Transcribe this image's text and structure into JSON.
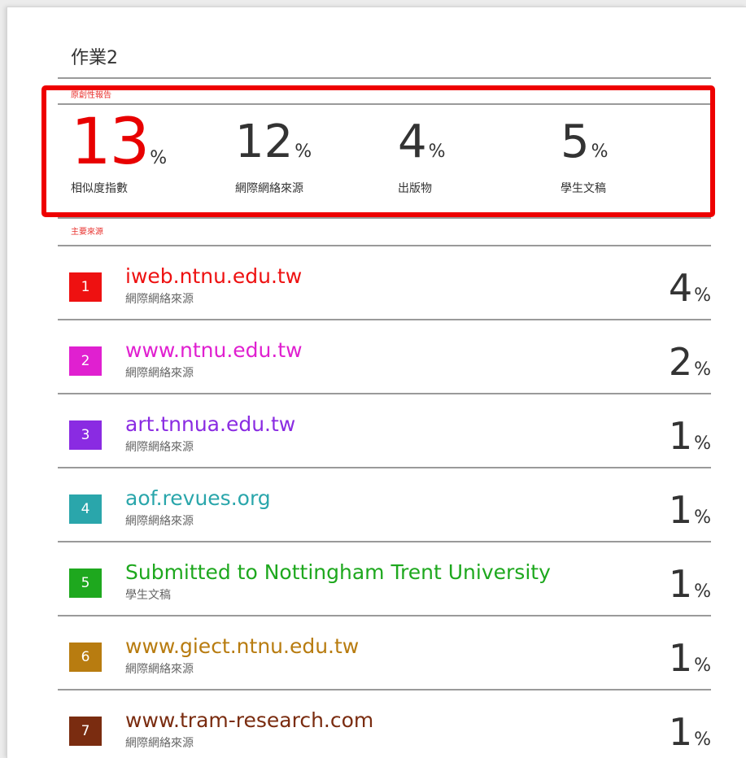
{
  "document_title": "作業2",
  "report_label": "原創性報告",
  "summary": [
    {
      "value": "13",
      "unit": "%",
      "caption": "相似度指數"
    },
    {
      "value": "12",
      "unit": "%",
      "caption": "網際網絡來源"
    },
    {
      "value": "4",
      "unit": "%",
      "caption": "出版物"
    },
    {
      "value": "5",
      "unit": "%",
      "caption": "學生文稿"
    }
  ],
  "primary_label": "主要來源",
  "sources": [
    {
      "rank": "1",
      "name": "iweb.ntnu.edu.tw",
      "type": "網際網絡來源",
      "percent": "4",
      "unit": "%",
      "color": "#ee1111"
    },
    {
      "rank": "2",
      "name": "www.ntnu.edu.tw",
      "type": "網際網絡來源",
      "percent": "2",
      "unit": "%",
      "color": "#e020d0"
    },
    {
      "rank": "3",
      "name": "art.tnnua.edu.tw",
      "type": "網際網絡來源",
      "percent": "1",
      "unit": "%",
      "color": "#8a2be2"
    },
    {
      "rank": "4",
      "name": "aof.revues.org",
      "type": "網際網絡來源",
      "percent": "1",
      "unit": "%",
      "color": "#2aa6ab"
    },
    {
      "rank": "5",
      "name": "Submitted to Nottingham Trent University",
      "type": "學生文稿",
      "percent": "1",
      "unit": "%",
      "color": "#1ea81e"
    },
    {
      "rank": "6",
      "name": "www.giect.ntnu.edu.tw",
      "type": "網際網絡來源",
      "percent": "1",
      "unit": "%",
      "color": "#b87c10"
    },
    {
      "rank": "7",
      "name": "www.tram-research.com",
      "type": "網際網絡來源",
      "percent": "1",
      "unit": "%",
      "color": "#7a2c10"
    }
  ]
}
